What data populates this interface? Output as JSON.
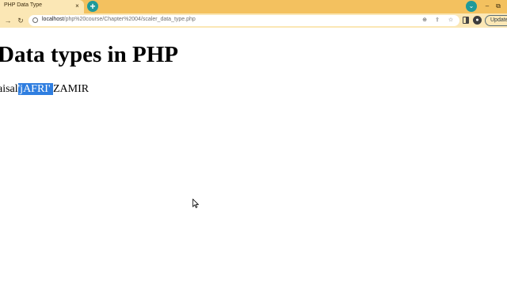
{
  "browser": {
    "tab": {
      "title": "PHP Data Type",
      "close_symbol": "×",
      "favicon": "page-icon"
    },
    "new_tab_symbol": "+",
    "tab_search_symbol": "⌄",
    "window_controls": {
      "minimize": "–",
      "maximize": "⧉"
    },
    "toolbar": {
      "forward_symbol": "→",
      "reload_symbol": "↻",
      "url_host": "localhost",
      "url_path": "/php%20course/Chapter%2004/scaler_data_type.php",
      "zoom_symbol": "⊕",
      "share_symbol": "⇪",
      "star_symbol": "☆",
      "profile_symbol": "●",
      "update_label": "Update"
    },
    "colors": {
      "tabstrip": "#f3c15f",
      "tab_active": "#fbe7b5",
      "accent": "#1f9a9a",
      "selection": "#2f7ee0"
    }
  },
  "page": {
    "heading": "Data types in PHP",
    "output": {
      "before": "aisal",
      "selected": "'jAFRI' ",
      "after": "ZAMIR"
    }
  }
}
